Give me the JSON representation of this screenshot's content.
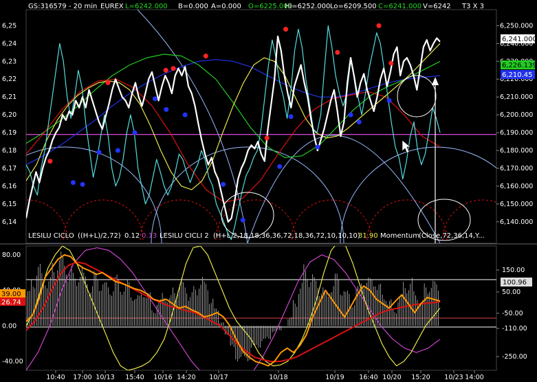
{
  "header": {
    "symbol": "GS:316579 - 20 min",
    "exchange": "EUREX",
    "last": "L=6242.000",
    "bid": "B=0.000",
    "ask": "A=0.000",
    "open": "O=6225.000",
    "high": "Hi=6252.000",
    "low": "Lo=6209.500",
    "close": "C=6241.000",
    "volume": "V=6242",
    "timeframe": "T3 X 3"
  },
  "lower_header": {
    "ind1_name": "LESILU CICLO",
    "ind1_params": "((H+L)/2,72)",
    "ind1_val_a": "0.12",
    "ind1_val_b": "0.13",
    "ind2_name": "LESILU CICLI 2",
    "ind2_params": "(H+L,2,18,18,36,36,72,18,36,72,10,10,10)",
    "ind2_val": "31.90",
    "ind3_name": "Momentum",
    "ind3_params": "(Close,72,36,14,Y..."
  },
  "badges": {
    "price_last": "6,241.000",
    "price_green": "6,226.139",
    "price_blue": "6,210.45",
    "left_orange": "39.00",
    "left_red": "26.74",
    "right_mom": "100.96"
  },
  "colors": {
    "price": "#ffffff",
    "cyan": "#55dddd",
    "yellow": "#e8e84a",
    "green": "#22cc22",
    "blue": "#2233ee",
    "red": "#dd1111",
    "magenta": "#cc44cc",
    "lightblue": "#99bbff",
    "orange": "#ff9900"
  },
  "chart_data": [
    {
      "type": "line",
      "title": "GS:316579 - 20 min",
      "y_ticks_right": [
        "6,250.000",
        "6,240.000",
        "6,230.000",
        "6,220.000",
        "6,210.000",
        "6,200.000",
        "6,190.000",
        "6,180.000",
        "6,170.000",
        "6,160.000",
        "6,150.000",
        "6,140.000"
      ],
      "y_ticks_left": [
        "6,25",
        "6,24",
        "6,23",
        "6,22",
        "6,21",
        "6,20",
        "6,19",
        "6,18",
        "6,17",
        "6,16",
        "6,15",
        "6,14"
      ],
      "ylim": [
        6128,
        6259
      ],
      "x_ticks": [
        "10:40",
        "17:00",
        "10/13",
        "15:40",
        "10/16",
        "14:20",
        "10/17",
        "10/18",
        "10/19",
        "16:40",
        "10/20",
        "15:20",
        "10/23",
        "14:00"
      ],
      "reference_line": 6189,
      "series": [
        {
          "color": "price",
          "values": [
            6142,
            6152,
            6160,
            6168,
            6162,
            6170,
            6176,
            6180,
            6186,
            6190,
            6193,
            6200,
            6197,
            6202,
            6200,
            6208,
            6204,
            6210,
            6204,
            6214,
            6208,
            6202,
            6196,
            6192,
            6199,
            6206,
            6214,
            6220,
            6215,
            6210,
            6208,
            6204,
            6212,
            6218,
            6210,
            6205,
            6212,
            6220,
            6224,
            6216,
            6208,
            6216,
            6222,
            6218,
            6212,
            6222,
            6226,
            6222,
            6227,
            6216,
            6212,
            6205,
            6195,
            6186,
            6178,
            6172,
            6176,
            6168,
            6164,
            6156,
            6148,
            6140,
            6142,
            6152,
            6164,
            6170,
            6174,
            6180,
            6183,
            6181,
            6185,
            6178,
            6174,
            6192,
            6206,
            6220,
            6244,
            6236,
            6222,
            6212,
            6204,
            6216,
            6222,
            6228,
            6218,
            6210,
            6198,
            6188,
            6180,
            6186,
            6192,
            6200,
            6208,
            6214,
            6202,
            6188,
            6196,
            6218,
            6232,
            6222,
            6210,
            6218,
            6223,
            6214,
            6208,
            6202,
            6210,
            6220,
            6226,
            6216,
            6224,
            6234,
            6238,
            6222,
            6230,
            6232,
            6228,
            6222,
            6214,
            6226,
            6238,
            6242,
            6236,
            6240,
            6243,
            6241
          ]
        },
        {
          "color": "cyan",
          "values": [
            6172,
            6168,
            6160,
            6155,
            6170,
            6180,
            6195,
            6210,
            6225,
            6240,
            6230,
            6210,
            6198,
            6210,
            6225,
            6215,
            6195,
            6180,
            6165,
            6175,
            6188,
            6200,
            6188,
            6170,
            6160,
            6165,
            6175,
            6190,
            6200,
            6190,
            6170,
            6160,
            6150,
            6155,
            6165,
            6175,
            6168,
            6160,
            6155,
            6160,
            6168,
            6178,
            6175,
            6168,
            6162,
            6168,
            6172,
            6180,
            6175,
            6165,
            6160,
            6150,
            6145,
            6140,
            6134,
            6130,
            6138,
            6148,
            6158,
            6166,
            6170,
            6176,
            6180,
            6192,
            6210,
            6228,
            6242,
            6232,
            6218,
            6210,
            6198,
            6214,
            6236,
            6248,
            6238,
            6220,
            6206,
            6192,
            6190,
            6200,
            6226,
            6250,
            6238,
            6222,
            6212,
            6205,
            6212,
            6230,
            6222,
            6210,
            6200,
            6212,
            6226,
            6236,
            6246,
            6240,
            6226,
            6210,
            6195,
            6182,
            6176,
            6164,
            6174,
            6188,
            6196,
            6180,
            6172,
            6178,
            6190,
            6204,
            6198,
            6190
          ]
        },
        {
          "color": "yellow",
          "values": [
            6163,
            6172,
            6186,
            6197,
            6205,
            6211,
            6215,
            6218,
            6219,
            6218,
            6214,
            6206,
            6194,
            6180,
            6168,
            6160,
            6158,
            6163,
            6174,
            6190,
            6205,
            6218,
            6228,
            6232,
            6230,
            6222,
            6210,
            6198,
            6190,
            6187,
            6188,
            6192,
            6197,
            6202,
            6207,
            6212,
            6217,
            6222,
            6228,
            6234,
            6240
          ]
        },
        {
          "color": "green",
          "values": [
            6184,
            6190,
            6197,
            6205,
            6214,
            6222,
            6228,
            6232,
            6234,
            6233,
            6228,
            6220,
            6207,
            6193,
            6182,
            6176,
            6177,
            6183,
            6193,
            6203,
            6211,
            6216,
            6220,
            6225,
            6230
          ]
        },
        {
          "color": "blue",
          "values": [
            6172,
            6177,
            6183,
            6190,
            6197,
            6205,
            6212,
            6218,
            6223,
            6227,
            6230,
            6231,
            6230,
            6227,
            6222,
            6217,
            6213,
            6210,
            6210,
            6212,
            6215,
            6218,
            6220,
            6221,
            6222
          ]
        },
        {
          "color": "red",
          "values": [
            6178,
            6190,
            6203,
            6213,
            6219,
            6220,
            6215,
            6205,
            6190,
            6172,
            6158,
            6151,
            6153,
            6163,
            6178,
            6192,
            6203,
            6209,
            6211,
            6213,
            6210,
            6200,
            6188,
            6182
          ]
        }
      ],
      "pivots_high": [
        [
          0.051,
          6174
        ],
        [
          0.174,
          6218
        ],
        [
          0.297,
          6225
        ],
        [
          0.313,
          6226
        ],
        [
          0.382,
          6233
        ],
        [
          0.512,
          6187
        ],
        [
          0.552,
          6248
        ],
        [
          0.662,
          6235
        ],
        [
          0.75,
          6250
        ],
        [
          0.776,
          6229
        ]
      ],
      "pivots_low": [
        [
          0.058,
          6127
        ],
        [
          0.1,
          6162
        ],
        [
          0.12,
          6161
        ],
        [
          0.155,
          6179
        ],
        [
          0.195,
          6180
        ],
        [
          0.231,
          6190
        ],
        [
          0.274,
          6209
        ],
        [
          0.298,
          6203
        ],
        [
          0.338,
          6200
        ],
        [
          0.419,
          6161
        ],
        [
          0.461,
          6141
        ],
        [
          0.539,
          6171
        ],
        [
          0.563,
          6199
        ],
        [
          0.62,
          6182
        ],
        [
          0.69,
          6200
        ],
        [
          0.708,
          6196
        ],
        [
          0.772,
          6208
        ]
      ]
    },
    {
      "type": "line",
      "title": "LESILU CICLO / LESILU CICLI 2 / Momentum",
      "y_ticks_left": [
        "80.00",
        "40.00",
        "0.00",
        "-40.00"
      ],
      "y_ticks_right": [
        "150.00",
        "50.00",
        "-50.00",
        "-110.00",
        "-250.00"
      ],
      "ylim": [
        -50,
        90
      ],
      "series": [
        {
          "color": "white",
          "style": "histogram",
          "values": [
            40,
            60,
            70,
            65,
            55,
            75,
            85,
            80,
            70,
            60,
            70,
            60,
            50,
            62,
            55,
            50,
            48,
            58,
            50,
            52,
            40,
            35,
            45,
            38,
            20,
            30,
            40,
            35,
            45,
            55,
            50,
            40,
            45,
            60,
            50,
            35,
            20,
            5,
            -10,
            -30,
            -40,
            -45,
            -40,
            -30,
            -25,
            -20,
            -15,
            -8,
            -5,
            0,
            10,
            30,
            50,
            70,
            62,
            55,
            48,
            40,
            52,
            60,
            48,
            40,
            30,
            45,
            60,
            55,
            62,
            48,
            40,
            30,
            20,
            35,
            52,
            55,
            40,
            30,
            48,
            55,
            50
          ]
        },
        {
          "color": "orange",
          "values": [
            5,
            12,
            30,
            55,
            65,
            75,
            80,
            78,
            70,
            65,
            62,
            58,
            60,
            55,
            50,
            48,
            45,
            42,
            40,
            36,
            30,
            28,
            30,
            25,
            20,
            22,
            18,
            15,
            10,
            12,
            15,
            10,
            0,
            -15,
            -28,
            -35,
            -40,
            -42,
            -45,
            -40,
            -30,
            -25,
            -30,
            -22,
            -10,
            10,
            25,
            40,
            30,
            20,
            10,
            22,
            35,
            45,
            40,
            30,
            25,
            20,
            28,
            35,
            25,
            15,
            25,
            32,
            30,
            28
          ]
        },
        {
          "color": "red",
          "values": [
            -5,
            5,
            20,
            40,
            58,
            68,
            72,
            70,
            65,
            60,
            55,
            50,
            45,
            40,
            35,
            30,
            26,
            22,
            20,
            17,
            15,
            10,
            5,
            0,
            -10,
            -20,
            -28,
            -35,
            -38,
            -40,
            -40,
            -38,
            -35,
            -30,
            -25,
            -20,
            -15,
            -10,
            -5,
            0,
            5,
            10,
            15,
            18,
            20,
            22,
            24,
            25,
            26,
            27
          ]
        },
        {
          "color": "yellow",
          "values": [
            0,
            15,
            40,
            65,
            80,
            90,
            85,
            70,
            50,
            30,
            10,
            -10,
            -30,
            -45,
            -50,
            -48,
            -45,
            -40,
            -30,
            -15,
            10,
            40,
            70,
            88,
            90,
            80,
            60,
            40,
            20,
            5,
            -5,
            -15,
            -30,
            -40,
            -45,
            -44,
            -40,
            -30,
            -15,
            5,
            30,
            60,
            85,
            95,
            90,
            70,
            45,
            20,
            0,
            -20,
            -35,
            -45,
            -40,
            -30,
            -15,
            0,
            10,
            20
          ]
        },
        {
          "color": "magenta",
          "values": [
            -50,
            -30,
            0,
            40,
            70,
            85,
            88,
            85,
            75,
            60,
            40,
            20,
            0,
            -20,
            -40,
            -55,
            -65,
            -68,
            -65,
            -55,
            -35,
            -10,
            20,
            50,
            72,
            80,
            75,
            60,
            40,
            20,
            0,
            -15,
            -25,
            -30,
            -25,
            -15
          ]
        }
      ]
    }
  ]
}
